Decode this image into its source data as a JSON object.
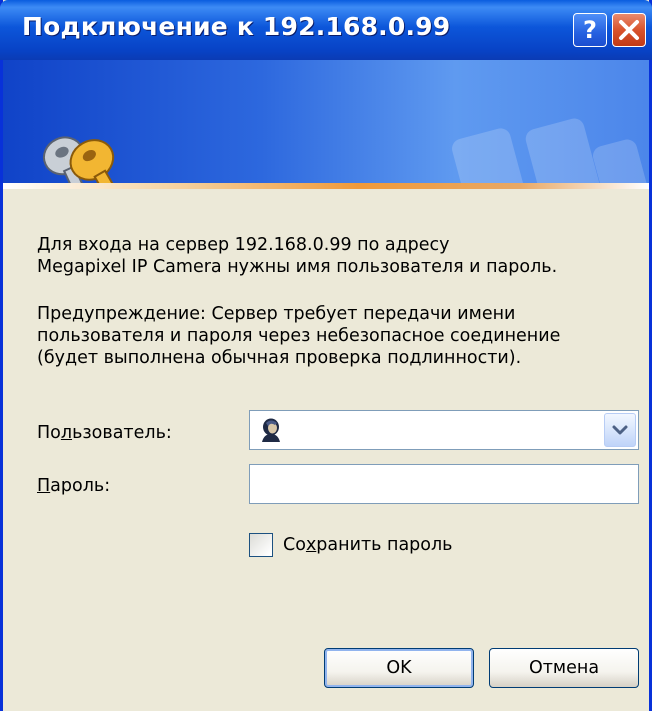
{
  "window": {
    "title": "Подключение к 192.168.0.99",
    "help_label": "?",
    "colors": {
      "titlebar": "#0c56da",
      "close_button": "#d9532c",
      "dialog_bg": "#ece9d8",
      "accent_line": "#f09a3a"
    }
  },
  "banner": {
    "icon": "keys-icon"
  },
  "message": {
    "line1": "Для входа на сервер 192.168.0.99 по адресу",
    "line2": "Megapixel IP Camera нужны имя пользователя и пароль.",
    "warning1": "Предупреждение: Сервер требует передачи имени",
    "warning2": "пользователя и пароля через небезопасное соединение",
    "warning3": "(будет выполнена обычная проверка подлинности)."
  },
  "form": {
    "user_label_pre": "По",
    "user_label_ul": "л",
    "user_label_post": "ьзователь:",
    "user_value": "",
    "user_icon": "user-icon",
    "password_label_ul": "П",
    "password_label_post": "ароль:",
    "password_value": "",
    "remember_pre": "Со",
    "remember_ul": "х",
    "remember_post": "ранить пароль",
    "remember_checked": false
  },
  "buttons": {
    "ok": "OK",
    "cancel": "Отмена"
  }
}
